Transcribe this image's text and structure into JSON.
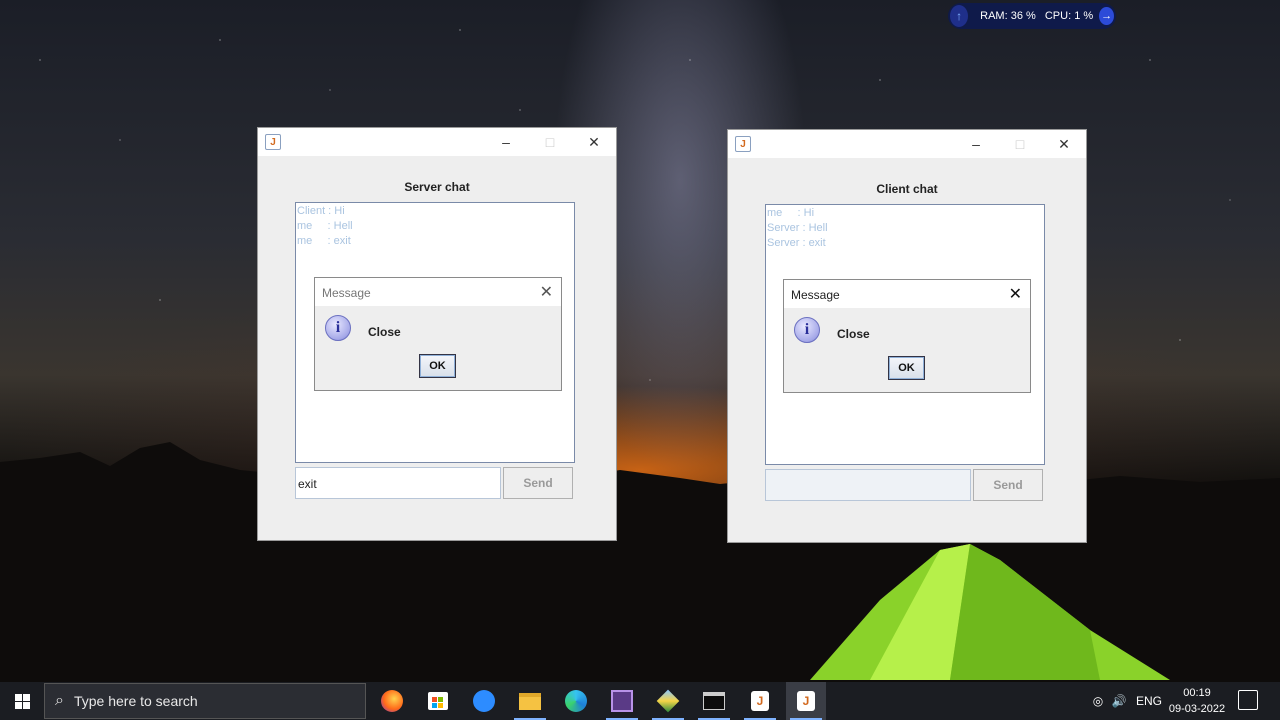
{
  "monitor": {
    "ram": "RAM: 36 %",
    "cpu": "CPU: 1 %"
  },
  "server_window": {
    "heading": "Server chat",
    "messages": [
      "Client : Hi",
      "me     : Hell",
      "me     : exit"
    ],
    "input_value": "exit",
    "send_label": "Send",
    "dialog": {
      "title": "Message",
      "text": "Close",
      "ok_label": "OK"
    }
  },
  "client_window": {
    "heading": "Client chat",
    "messages": [
      "me     : Hi",
      "Server : Hell",
      "Server : exit"
    ],
    "input_value": "",
    "send_label": "Send",
    "dialog": {
      "title": "Message",
      "text": "Close",
      "ok_label": "OK"
    }
  },
  "taskbar": {
    "search_placeholder": "Type here to search",
    "apps": [
      "firefox-icon",
      "microsoft-store-icon",
      "zoom-icon",
      "file-explorer-icon",
      "edge-icon",
      "game-icon",
      "virtualbox-icon",
      "terminal-icon",
      "java-icon",
      "java-icon"
    ],
    "language": "ENG",
    "time": "00:19",
    "date": "09-03-2022"
  },
  "colors": {
    "chat_text": "#aac4e0",
    "taskbar_bg": "#1b1d22",
    "monitor_bg": "#0f1a4a",
    "window_bg": "#eeeeee"
  }
}
